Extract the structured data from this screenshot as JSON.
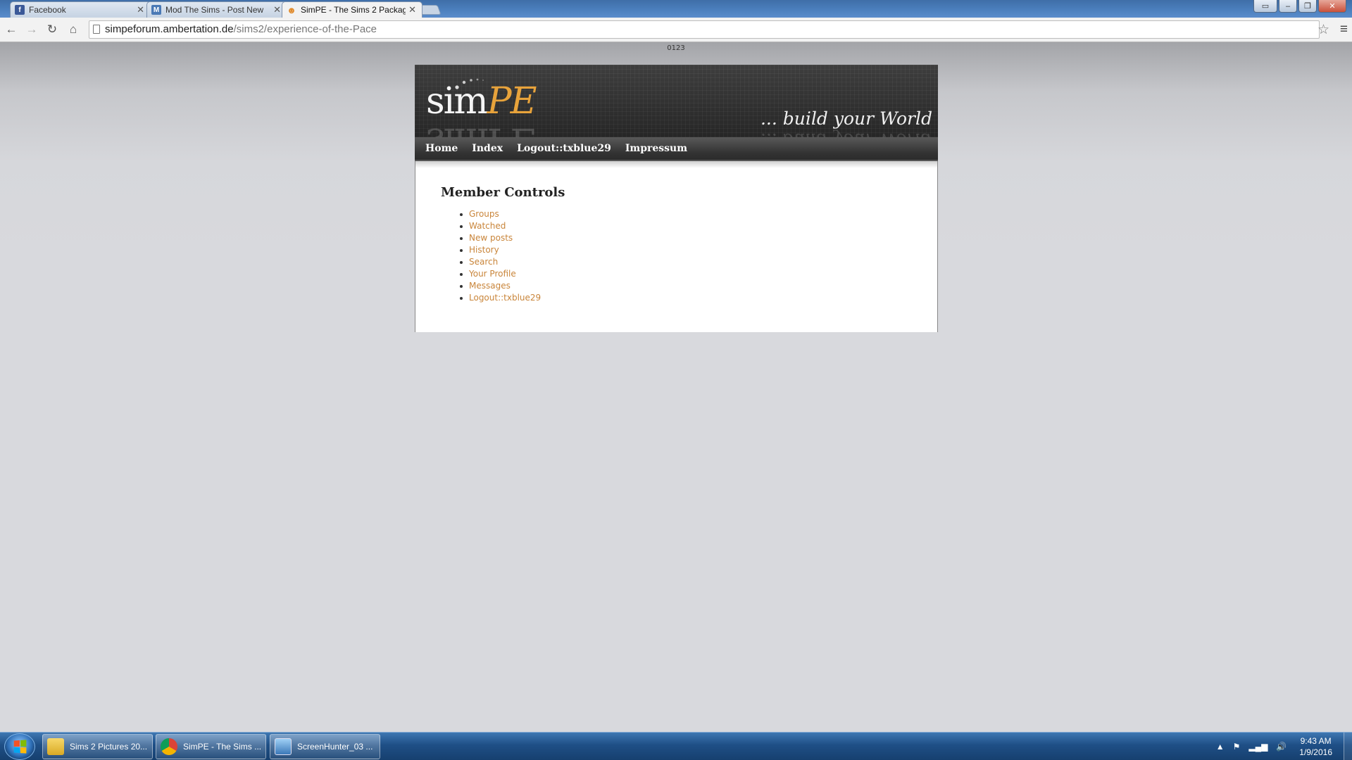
{
  "browser": {
    "tabs": [
      {
        "title": "Facebook",
        "favicon": "f",
        "favicon_color": "#3b5998",
        "active": false
      },
      {
        "title": "Mod The Sims - Post New",
        "favicon": "M",
        "favicon_color": "#4a79b5",
        "active": false
      },
      {
        "title": "SimPE - The Sims 2 Packag",
        "favicon": "☻",
        "favicon_color": "#e08a2a",
        "active": true
      }
    ],
    "url_host": "simpeforum.ambertation.de",
    "url_path": "/sims2/experience-of-the-Pace"
  },
  "page": {
    "counter": "0123",
    "logo_sim": "sim",
    "logo_pe": "PE",
    "slogan": "... build your World",
    "nav": [
      "Home",
      "Index",
      "Logout::txblue29",
      "Impressum"
    ],
    "heading": "Member Controls",
    "links": [
      "Groups",
      "Watched",
      "New posts",
      "History",
      "Search",
      "Your Profile",
      "Messages",
      "Logout::txblue29"
    ],
    "link_color": "#c9853a"
  },
  "taskbar": {
    "items": [
      {
        "label": "Sims 2 Pictures 20...",
        "icon": "folder-icon"
      },
      {
        "label": "SimPE - The Sims ...",
        "icon": "chrome-icon"
      },
      {
        "label": "ScreenHunter_03 ...",
        "icon": "image-viewer-icon"
      }
    ],
    "time": "9:43 AM",
    "date": "1/9/2016"
  }
}
